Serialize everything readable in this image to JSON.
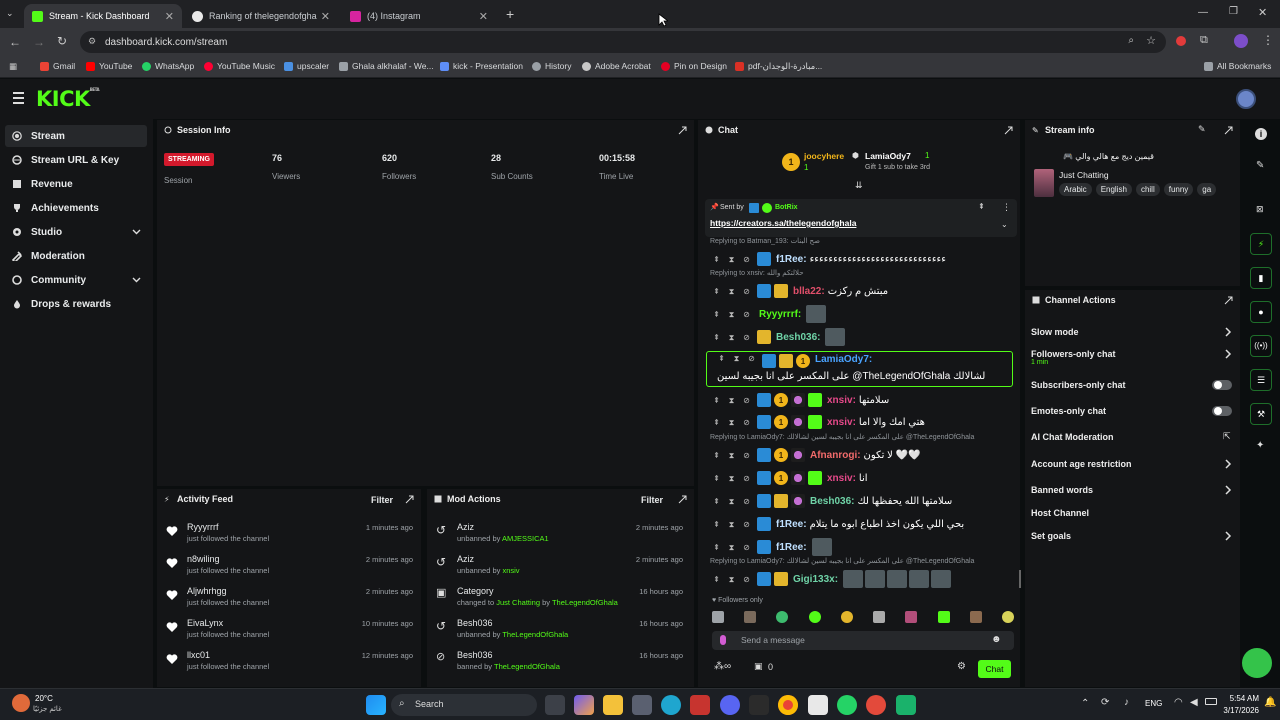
{
  "browser": {
    "tabs": [
      {
        "title": "Stream - Kick Dashboard",
        "favicon_color": "#53fc18"
      },
      {
        "title": "Ranking of thelegendofghala | ...",
        "favicon_color": "#e9e9e9"
      },
      {
        "title": "(4) Instagram",
        "favicon_color": "#d6249f"
      }
    ],
    "url": "dashboard.kick.com/stream",
    "bookmarks": [
      "Gmail",
      "YouTube",
      "WhatsApp",
      "YouTube Music",
      "upscaler",
      "Ghala alkhalaf - We...",
      "kick - Presentation",
      "History",
      "Adobe Acrobat",
      "Pin on Design",
      "pdf-مبادرة-الوجدان..."
    ],
    "all_bookmarks": "All Bookmarks"
  },
  "nav": {
    "logo": "KICK",
    "badge": "BETA"
  },
  "sidebar": {
    "items": [
      {
        "label": "Stream",
        "icon": "stream-icon"
      },
      {
        "label": "Stream URL & Key",
        "icon": "link-icon"
      },
      {
        "label": "Revenue",
        "icon": "revenue-icon"
      },
      {
        "label": "Achievements",
        "icon": "trophy-icon"
      },
      {
        "label": "Studio",
        "icon": "studio-icon"
      },
      {
        "label": "Moderation",
        "icon": "moderation-icon"
      },
      {
        "label": "Community",
        "icon": "community-icon"
      },
      {
        "label": "Drops & rewards",
        "icon": "drops-icon"
      }
    ]
  },
  "session": {
    "title": "Session Info",
    "status": "STREAMING",
    "session_label": "Session",
    "stats": [
      {
        "value": "76",
        "label": "Viewers"
      },
      {
        "value": "620",
        "label": "Followers"
      },
      {
        "value": "28",
        "label": "Sub Counts"
      },
      {
        "value": "00:15:58",
        "label": "Time Live"
      }
    ]
  },
  "activity": {
    "title": "Activity Feed",
    "filter": "Filter",
    "items": [
      {
        "name": "Ryyyrrrf",
        "desc": "just followed the channel",
        "time": "1 minutes ago"
      },
      {
        "name": "n8wiling",
        "desc": "just followed the channel",
        "time": "2 minutes ago"
      },
      {
        "name": "Aljwhrhgg",
        "desc": "just followed the channel",
        "time": "2 minutes ago"
      },
      {
        "name": "EivaLynx",
        "desc": "just followed the channel",
        "time": "10 minutes ago"
      },
      {
        "name": "llxc01",
        "desc": "just followed the channel",
        "time": "12 minutes ago"
      }
    ]
  },
  "mod": {
    "title": "Mod Actions",
    "filter": "Filter",
    "items": [
      {
        "name": "Aziz",
        "prefix": "unbanned by",
        "actor": "AMJESSICA1",
        "time": "2 minutes ago",
        "icon": "undo-icon"
      },
      {
        "name": "Aziz",
        "prefix": "unbanned by",
        "actor": "xnsiv",
        "time": "2 minutes ago",
        "icon": "undo-icon"
      },
      {
        "name": "Category",
        "prefix": "changed to",
        "actor": "Just Chatting",
        "suffix": "by",
        "actor2": "TheLegendOfGhala",
        "time": "16 hours ago",
        "icon": "category-icon"
      },
      {
        "name": "Besh036",
        "prefix": "unbanned by",
        "actor": "TheLegendOfGhala",
        "time": "16 hours ago",
        "icon": "undo-icon"
      },
      {
        "name": "Besh036",
        "prefix": "banned by",
        "actor": "TheLegendOfGhala",
        "time": "16 hours ago",
        "icon": "ban-icon"
      }
    ]
  },
  "chat": {
    "title": "Chat",
    "gift": {
      "gifter": "joocyhere",
      "recipient": "LamiaOdy7",
      "count": "1",
      "text": "Gift 1 sub to take 3rd"
    },
    "pinned": {
      "sent_by": "Sent by",
      "bot": "BotRix",
      "link": "https://creators.sa/thelegendofghala"
    },
    "messages": [
      {
        "reply": "Replying to Batman_193: صح البنات",
        "user": "f1Ree:",
        "color": "#bfe0ff",
        "text": "ءءءءءءءءءءءءءءءءءءءءءءءءءءءءء"
      },
      {
        "reply": "Replying to xnsiv: حلالتكم والله",
        "user": "blla22:",
        "color": "#e04f6a",
        "text": "مبتش م ركزت"
      },
      {
        "reply": "",
        "user": "Ryyyrrrf:",
        "color": "#53fc18",
        "text": ""
      },
      {
        "reply": "",
        "user": "Besh036:",
        "color": "#6fd3a7",
        "text": ""
      },
      {
        "reply": "",
        "user": "LamiaOdy7:",
        "color": "#4aa3ff",
        "text": "على المكسر على انا بجيبه لسين @TheLegendOfGhala لشالالك"
      },
      {
        "reply": "",
        "user": "xnsiv:",
        "color": "#e6498a",
        "text": "سلامتها"
      },
      {
        "reply": "",
        "user": "xnsiv:",
        "color": "#e6498a",
        "text": "هتي امك والا اما"
      },
      {
        "reply": "Replying to LamiaOdy7: على المكسر على انا بجيبه لسين لشالالك @TheLegendOfGhala",
        "user": "Afnanrogi:",
        "color": "#f26b6b",
        "text": "لا تكون 🤍🤍"
      },
      {
        "reply": "",
        "user": "xnsiv:",
        "color": "#e6498a",
        "text": "انا"
      },
      {
        "reply": "",
        "user": "Besh036:",
        "color": "#6fd3a7",
        "text": "سلامتها الله يحفظها لك"
      },
      {
        "reply": "",
        "user": "f1Ree:",
        "color": "#bfe0ff",
        "text": "بحي اللي يكون اخذ اطباع ابوه ما يتلام"
      },
      {
        "reply": "",
        "user": "f1Ree:",
        "color": "#bfe0ff",
        "text": ""
      },
      {
        "reply": "Replying to LamiaOdy7: على المكسر على انا بجيبه لسين لشالالك @TheLegendOfGhala",
        "user": "Gigi133x:",
        "color": "#6fd3a7",
        "text": ""
      }
    ],
    "followers_only": "Followers only",
    "placeholder": "Send a message",
    "count": "0",
    "send": "Chat"
  },
  "stream_info": {
    "title": "Stream info",
    "stream_title": "قيمين ديج مع هالي والي 🎮",
    "category": "Just Chatting",
    "tags": [
      "Arabic",
      "English",
      "chill",
      "funny",
      "ga"
    ]
  },
  "channel_actions": {
    "title": "Channel Actions",
    "items": [
      {
        "label": "Slow mode",
        "sub": "",
        "control": "arrow"
      },
      {
        "label": "Followers-only chat",
        "sub": "1 min",
        "control": "arrow"
      },
      {
        "label": "Subscribers-only chat",
        "sub": "",
        "control": "toggle"
      },
      {
        "label": "Emotes-only chat",
        "sub": "",
        "control": "toggle"
      },
      {
        "label": "AI Chat Moderation",
        "sub": "",
        "control": "external"
      },
      {
        "label": "Account age restriction",
        "sub": "",
        "control": "arrow"
      },
      {
        "label": "Banned words",
        "sub": "",
        "control": "arrow"
      },
      {
        "label": "Host Channel",
        "sub": "",
        "control": "none"
      },
      {
        "label": "Set goals",
        "sub": "",
        "control": "arrow"
      }
    ]
  },
  "taskbar": {
    "weather_temp": "20°C",
    "weather_desc": "غائم جزئيًا",
    "search": "Search",
    "lang": "ENG",
    "time": "5:54 AM",
    "date": "3/17/2026"
  }
}
